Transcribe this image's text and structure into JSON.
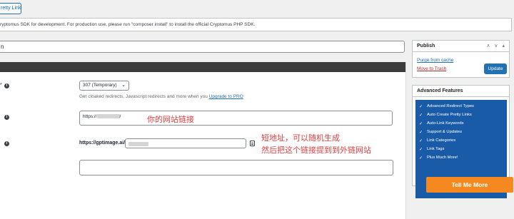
{
  "top_button_label": "retty Link",
  "notice_text": "ryptomus SDK for development. For production use, please run \"composer install\" to install the official Cryptomus PHP SDK.",
  "title_value": "n",
  "form": {
    "redirect_label": "*",
    "redirect_select_value": "307 (Temporary)",
    "redirect_hint_prefix": "Get cloaked redirects, Javascript redirects and more when you ",
    "redirect_hint_link": "Upgrade to PRO",
    "target_url_prefix": "https://",
    "target_url_suffix": "/",
    "slug_prefix": "https://gptimage.ai/",
    "annotation_target": "你的网站链接",
    "annotation_slug_line1": "短地址，可以随机生成",
    "annotation_slug_line2": "然后把这个链接提到到外链网站"
  },
  "publish": {
    "title": "Publish",
    "arrows": "∧ ∨ ▴",
    "purge_link": "Purge from cache",
    "trash_link": "Move to Trash",
    "update_button": "Update"
  },
  "advanced": {
    "title": "Advanced Features",
    "items": [
      "Advanced Redirect Types",
      "Auto Create Pretty Links",
      "Auto-Link Keywords",
      "Support & Updates",
      "Link Categories",
      "Link Tags",
      "Plus Much More!"
    ],
    "cta": "Tell Me More"
  },
  "colors": {
    "primary": "#2271b1",
    "annotation": "#e04040",
    "promo_bg": "#1a5ba8",
    "cta_bg": "#f5891f"
  }
}
